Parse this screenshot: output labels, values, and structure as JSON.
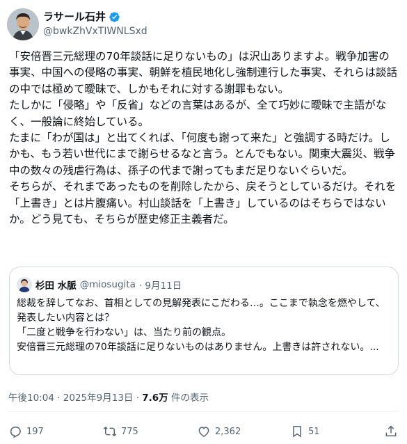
{
  "author": {
    "display_name": "ラサール石井",
    "handle": "@bwkZhVxTIWNLSxd"
  },
  "post": {
    "paragraphs": [
      "「安倍晋三元総理の70年談話に足りないもの」は沢山ありますよ。戦争加害の事実、中国への侵略の事実、朝鮮を植民地化し強制連行した事実、それらは談話の中では極めて曖昧で、しかもそれに対する謝罪もない。",
      "たしかに「侵略」や「反省」などの言葉はあるが、全て巧妙に曖昧で主語がなく、一般論に終始している。",
      "たまに「わが国は」と出てくれば、「何度も謝って来た」と強調する時だけ。しかも、もう若い世代にまで謝らせるなと言う。とんでもない。関東大震災、戦争中の数々の残虐行為は、孫子の代まで謝ってもまだ足りないぐらいだ。",
      "そちらが、それまであったものを削除したから、戻そうとしているだけ。それを「上書き」とは片腹痛い。村山談話を「上書き」しているのはそちらではないか。どう見ても、そちらが歴史修正主義者だ。"
    ]
  },
  "quoted": {
    "display_name": "杉田 水脈",
    "handle": "@miosugita",
    "date": "· 9月11日",
    "lines": [
      "総裁を辞してなお、首相としての見解発表にこだわる…。ここまで執念を燃やして、発表したい内容とは？",
      "「二度と戦争を行わない」は、当たり前の観点。",
      "安倍晋三元総理の70年談話に足りないものはありません。上書きは許されない。..."
    ]
  },
  "meta": {
    "timestamp": "午後10:04 · 2025年9月13日 · ",
    "views_count": "7.6万",
    "views_label": " 件の表示"
  },
  "actions": {
    "replies": "197",
    "reposts": "775",
    "likes": "2,362",
    "bookmarks": "51"
  },
  "colors": {
    "verified": "#1d9bf0",
    "secondary_text": "#536471"
  }
}
